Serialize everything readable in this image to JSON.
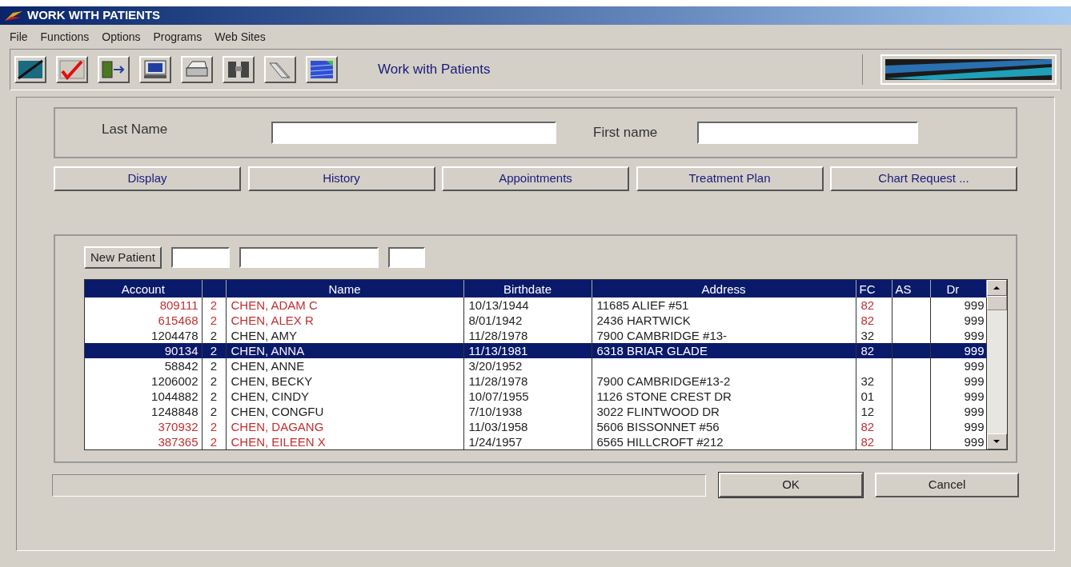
{
  "window": {
    "title": "WORK WITH PATIENTS"
  },
  "menu": [
    "File",
    "Functions",
    "Options",
    "Programs",
    "Web Sites"
  ],
  "toolbar": {
    "title": "Work with Patients"
  },
  "search": {
    "fields": [
      {
        "label": "Last Name"
      },
      {
        "label": "First name"
      }
    ]
  },
  "actions": [
    "Display",
    "History",
    "Appointments",
    "Treatment Plan",
    "Chart Request ..."
  ],
  "new_patient": "New Patient",
  "table": {
    "columns": [
      "Account",
      "Name",
      "Birthdate",
      "Address",
      "FC",
      "AS",
      "Dr"
    ],
    "rows": [
      {
        "account": "809111",
        "column_2": "2",
        "name": "CHEN, ADAM C",
        "birthdate": "10/13/1944",
        "address": "11685 ALIEF #51",
        "fc": "82",
        "dr": "999",
        "flagged": true,
        "selected": false
      },
      {
        "account": "615468",
        "column_2": "2",
        "name": "CHEN, ALEX R",
        "birthdate": "8/01/1942",
        "address": "2436 HARTWICK",
        "fc": "82",
        "dr": "999",
        "flagged": true,
        "selected": false
      },
      {
        "account": "1204478",
        "column_2": "2",
        "name": "CHEN, AMY",
        "birthdate": "11/28/1978",
        "address": "7900 CAMBRIDGE #13-",
        "fc": "32",
        "dr": "999",
        "flagged": false,
        "selected": false
      },
      {
        "account": "90134",
        "column_2": "2",
        "name": "CHEN, ANNA",
        "birthdate": "11/13/1981",
        "address": "6318 BRIAR GLADE",
        "fc": "82",
        "dr": "999",
        "flagged": true,
        "selected": true
      },
      {
        "account": "58842",
        "column_2": "2",
        "name": "CHEN, ANNE",
        "birthdate": "3/20/1952",
        "address": "",
        "fc": "",
        "dr": "999",
        "flagged": false,
        "selected": false
      },
      {
        "account": "1206002",
        "column_2": "2",
        "name": "CHEN, BECKY",
        "birthdate": "11/28/1978",
        "address": "7900 CAMBRIDGE#13-2",
        "fc": "32",
        "dr": "999",
        "flagged": false,
        "selected": false
      },
      {
        "account": "1044882",
        "column_2": "2",
        "name": "CHEN, CINDY",
        "birthdate": "10/07/1955",
        "address": "1126 STONE CREST DR",
        "fc": "01",
        "dr": "999",
        "flagged": false,
        "selected": false
      },
      {
        "account": "1248848",
        "column_2": "2",
        "name": "CHEN, CONGFU",
        "birthdate": "7/10/1938",
        "address": "3022 FLINTWOOD DR",
        "fc": "12",
        "dr": "999",
        "flagged": false,
        "selected": false
      },
      {
        "account": "370932",
        "column_2": "2",
        "name": "CHEN, DAGANG",
        "birthdate": "11/03/1958",
        "address": "5606 BISSONNET #56",
        "fc": "82",
        "dr": "999",
        "flagged": true,
        "selected": false
      },
      {
        "account": "387365",
        "column_2": "2",
        "name": "CHEN, EILEEN X",
        "birthdate": "1/24/1957",
        "address": "6565 HILLCROFT #212",
        "fc": "82",
        "dr": "999",
        "flagged": true,
        "selected": false
      }
    ]
  },
  "buttons": [
    "OK",
    "Cancel"
  ]
}
